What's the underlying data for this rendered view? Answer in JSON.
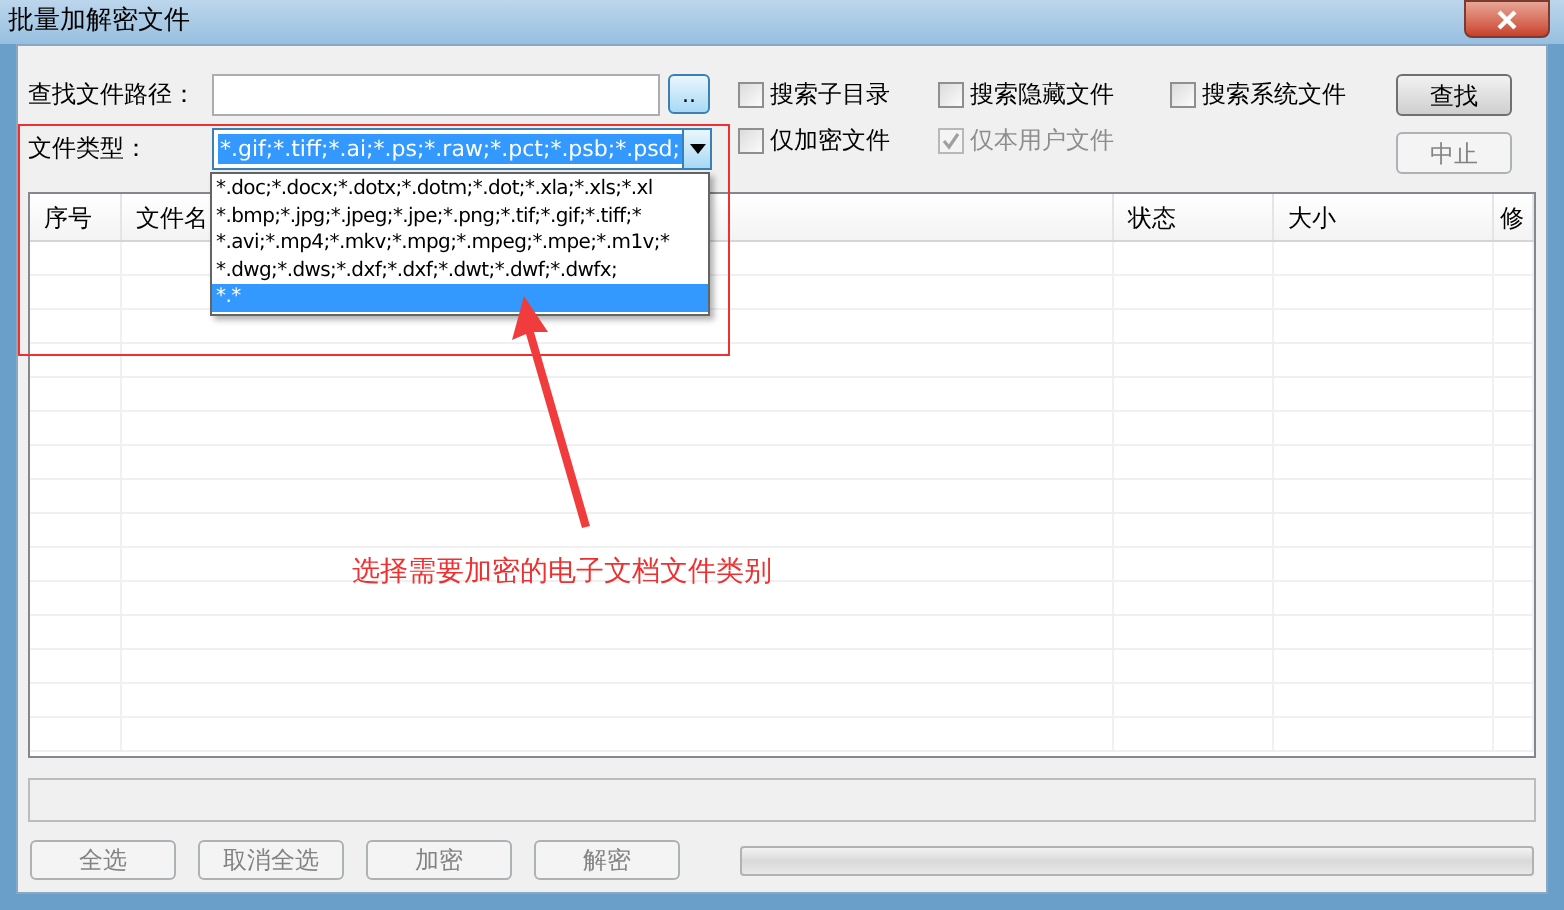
{
  "window": {
    "title": "批量加解密文件"
  },
  "search": {
    "path_label": "查找文件路径：",
    "browse_button": "..",
    "type_label": "文件类型：",
    "type_value": "*.gif;*.tiff;*.ai;*.ps;*.raw;*.pct;*.psb;*.psd;"
  },
  "options": [
    {
      "label": "搜索子目录",
      "checked": false,
      "disabled": false
    },
    {
      "label": "搜索隐藏文件",
      "checked": false,
      "disabled": false
    },
    {
      "label": "搜索系统文件",
      "checked": false,
      "disabled": false
    },
    {
      "label": "仅加密文件",
      "checked": false,
      "disabled": false
    },
    {
      "label": "仅本用户文件",
      "checked": true,
      "disabled": true
    }
  ],
  "actions": [
    {
      "label": "查找",
      "disabled": false
    },
    {
      "label": "中止",
      "disabled": true
    }
  ],
  "dropdown": {
    "expanded": true,
    "items": [
      {
        "label": "*.doc;*.docx;*.dotx;*.dotm;*.dot;*.xla;*.xls;*.xl",
        "selected": false
      },
      {
        "label": "*.bmp;*.jpg;*.jpeg;*.jpe;*.png;*.tif;*.gif;*.tiff;*",
        "selected": false
      },
      {
        "label": "*.avi;*.mp4;*.mkv;*.mpg;*.mpeg;*.mpe;*.m1v;*",
        "selected": false
      },
      {
        "label": "*.dwg;*.dws;*.dxf;*.dxf;*.dwt;*.dwf;*.dwfx;",
        "selected": false
      },
      {
        "label": "*.*",
        "selected": true
      }
    ]
  },
  "table": {
    "columns": [
      "序号",
      "文件名",
      "状态",
      "大小",
      "修"
    ]
  },
  "bottom_buttons": [
    {
      "label": "全选",
      "disabled": true
    },
    {
      "label": "取消全选",
      "disabled": true
    },
    {
      "label": "加密",
      "disabled": true
    },
    {
      "label": "解密",
      "disabled": true
    }
  ],
  "progress": {
    "level": 0
  },
  "annotation": {
    "text": "选择需要加密的电子文档文件类别"
  }
}
